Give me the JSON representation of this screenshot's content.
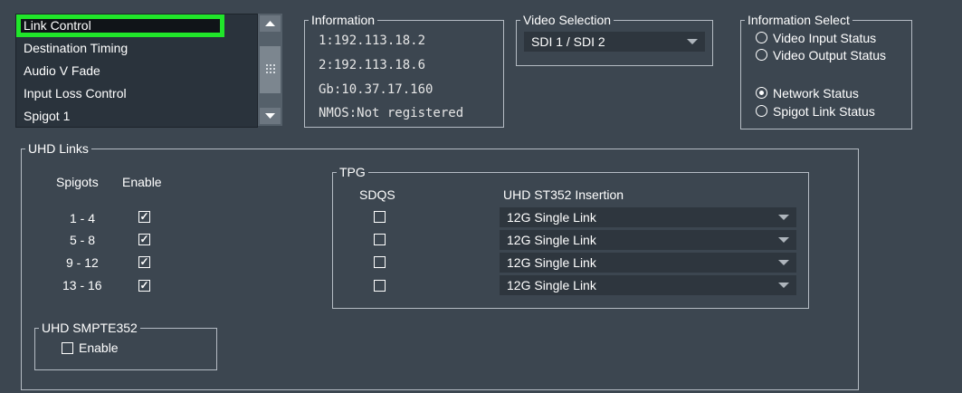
{
  "menu_list": {
    "items": [
      {
        "label": "Link Control",
        "selected": true
      },
      {
        "label": "Destination Timing",
        "selected": false
      },
      {
        "label": "Audio V Fade",
        "selected": false
      },
      {
        "label": "Input Loss Control",
        "selected": false
      },
      {
        "label": "Spigot 1",
        "selected": false
      }
    ],
    "highlight_color": "#20e62a"
  },
  "information": {
    "title": "Information",
    "lines": [
      "1:192.113.18.2",
      "2:192.113.18.6",
      "Gb:10.37.17.160",
      "NMOS:Not registered"
    ]
  },
  "video_selection": {
    "title": "Video Selection",
    "value": "SDI 1 / SDI 2"
  },
  "information_select": {
    "title": "Information Select",
    "options": [
      {
        "label": "Video Input Status",
        "selected": false
      },
      {
        "label": "Video Output Status",
        "selected": false
      },
      {
        "label": "Network Status",
        "selected": true
      },
      {
        "label": "Spigot Link Status",
        "selected": false
      }
    ]
  },
  "uhd_links": {
    "title": "UHD Links",
    "col_spigots": "Spigots",
    "col_enable": "Enable",
    "rows": [
      {
        "spigots": "1 - 4",
        "enabled": true
      },
      {
        "spigots": "5 - 8",
        "enabled": true
      },
      {
        "spigots": "9 - 12",
        "enabled": true
      },
      {
        "spigots": "13 - 16",
        "enabled": true
      }
    ]
  },
  "tpg": {
    "title": "TPG",
    "col_sdqs": "SDQS",
    "col_insertion": "UHD ST352 Insertion",
    "rows": [
      {
        "sdqs": false,
        "insertion": "12G Single Link"
      },
      {
        "sdqs": false,
        "insertion": "12G Single Link"
      },
      {
        "sdqs": false,
        "insertion": "12G Single Link"
      },
      {
        "sdqs": false,
        "insertion": "12G Single Link"
      }
    ]
  },
  "uhd_smpte352": {
    "title": "UHD SMPTE352",
    "enable_label": "Enable",
    "enabled": false
  }
}
